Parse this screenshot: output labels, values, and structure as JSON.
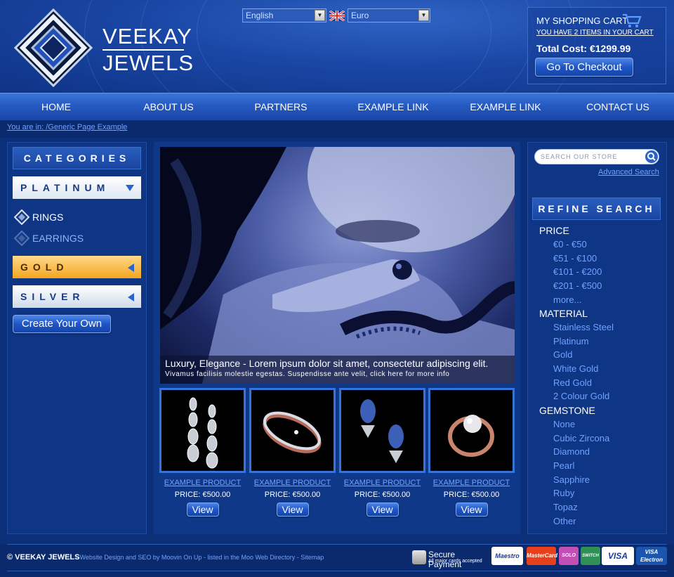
{
  "brand": {
    "line1": "VEEKAY",
    "line2": "JEWELS"
  },
  "selectors": {
    "language": "English",
    "currency": "Euro"
  },
  "cart": {
    "title": "MY SHOPPING CART",
    "items_text": "YOU HAVE 2 ITEMS IN YOUR CART",
    "total_text": "Total Cost: €1299.99",
    "checkout_label": "Go To Checkout"
  },
  "nav": [
    "HOME",
    "ABOUT US",
    "PARTNERS",
    "EXAMPLE LINK",
    "EXAMPLE LINK",
    "CONTACT US"
  ],
  "breadcrumb": "You are in: /Generic Page Example",
  "categories": {
    "title": "CATEGORIES",
    "platinum": "PLATINUM",
    "sub": [
      "RINGS",
      "EARRINGS"
    ],
    "gold": "GOLD",
    "silver": "SILVER",
    "create": "Create Your Own"
  },
  "hero": {
    "headline": "Luxury, Elegance - Lorem ipsum dolor sit amet, consectetur adipiscing elit.",
    "sub": "Vivamus facilisis molestie egestas. Suspendisse ante velit, ",
    "more_link": "click here for more info"
  },
  "products": [
    {
      "name": "EXAMPLE PRODUCT",
      "price": "PRICE: €500.00",
      "view": "View"
    },
    {
      "name": "EXAMPLE PRODUCT",
      "price": "PRICE: €500.00",
      "view": "View"
    },
    {
      "name": "EXAMPLE PRODUCT",
      "price": "PRICE: €500.00",
      "view": "View"
    },
    {
      "name": "EXAMPLE PRODUCT",
      "price": "PRICE: €500.00",
      "view": "View"
    }
  ],
  "search": {
    "placeholder": "SEARCH OUR STORE",
    "advanced": "Advanced Search"
  },
  "refine": {
    "title": "REFINE SEARCH",
    "price_h": "PRICE",
    "price": [
      "€0 - €50",
      "€51 - €100",
      "€101 - €200",
      "€201 - €500",
      "more..."
    ],
    "material_h": "MATERIAL",
    "material": [
      "Stainless Steel",
      "Platinum",
      "Gold",
      "White Gold",
      "Red Gold",
      "2 Colour Gold"
    ],
    "gemstone_h": "GEMSTONE",
    "gemstone": [
      "None",
      "Cubic Zircona",
      "Diamond",
      "Pearl",
      "Sapphire",
      "Ruby",
      "Topaz",
      "Other"
    ]
  },
  "footer": {
    "copyright": "© VEEKAY JEWELS",
    "links": "- Website Design and SEO by Moovin On Up - listed in the Moo Web Directory - Sitemap",
    "secure_title": "Secure Payment",
    "secure_sub": "All major cards accepted",
    "cards": [
      "Maestro",
      "MasterCard",
      "SOLO",
      "SWITCH",
      "VISA",
      "VISA Electron"
    ]
  },
  "colors": {
    "accent": "#1f56c5",
    "link": "#6fa3ff",
    "background": "#0b2a6e"
  },
  "icons": [
    "cart-icon",
    "search-icon",
    "diamond-icon",
    "flag-uk-icon",
    "lock-icon"
  ]
}
